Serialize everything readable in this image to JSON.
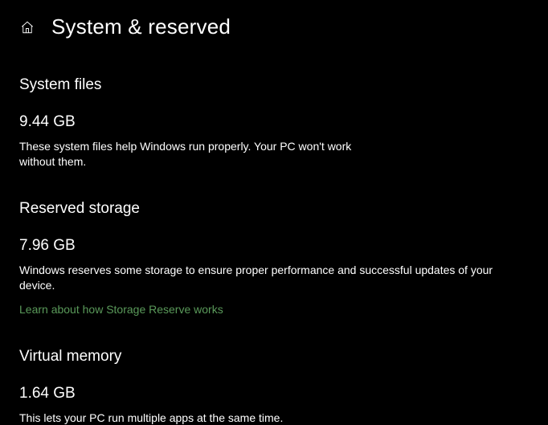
{
  "header": {
    "title": "System & reserved"
  },
  "sections": {
    "systemFiles": {
      "heading": "System files",
      "value": "9.44 GB",
      "description": "These system files help Windows run properly. Your PC won't work without them."
    },
    "reservedStorage": {
      "heading": "Reserved storage",
      "value": "7.96 GB",
      "description": "Windows reserves some storage to ensure proper performance and successful updates of your device.",
      "linkText": "Learn about how Storage Reserve works"
    },
    "virtualMemory": {
      "heading": "Virtual memory",
      "value": "1.64 GB",
      "description": "This lets your PC run multiple apps at the same time."
    }
  }
}
